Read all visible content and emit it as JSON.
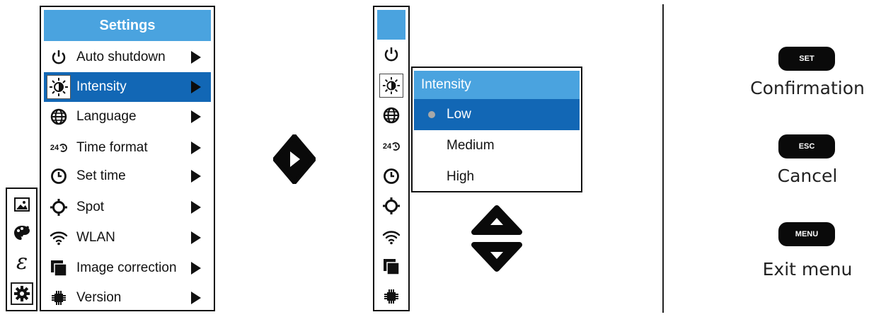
{
  "settings_menu": {
    "title": "Settings",
    "items": [
      {
        "label": "Auto shutdown",
        "icon": "power-icon"
      },
      {
        "label": "Intensity",
        "icon": "brightness-icon",
        "selected": true
      },
      {
        "label": "Language",
        "icon": "globe-icon"
      },
      {
        "label": "Time format",
        "icon": "time-format-icon",
        "icon_text": "24"
      },
      {
        "label": "Set time",
        "icon": "clock-icon"
      },
      {
        "label": "Spot",
        "icon": "crosshair-icon"
      },
      {
        "label": "WLAN",
        "icon": "wifi-icon"
      },
      {
        "label": "Image correction",
        "icon": "image-correction-icon"
      },
      {
        "label": "Version",
        "icon": "chip-icon"
      }
    ]
  },
  "category_strip": {
    "items": [
      {
        "icon": "image-icon"
      },
      {
        "icon": "palette-icon"
      },
      {
        "icon": "emissivity-icon",
        "glyph": "ε"
      },
      {
        "icon": "gear-icon",
        "selected": true
      }
    ]
  },
  "intensity_submenu": {
    "title": "Intensity",
    "options": [
      {
        "label": "Low",
        "selected": true
      },
      {
        "label": "Medium"
      },
      {
        "label": "High"
      }
    ]
  },
  "legend": {
    "set": {
      "key": "SET",
      "label": "Confirmation"
    },
    "esc": {
      "key": "ESC",
      "label": "Cancel"
    },
    "menu": {
      "key": "MENU",
      "label": "Exit menu"
    }
  },
  "colors": {
    "title_bar": "#4aa3df",
    "selection": "#1267b5",
    "key_background": "#0a0a0a"
  }
}
